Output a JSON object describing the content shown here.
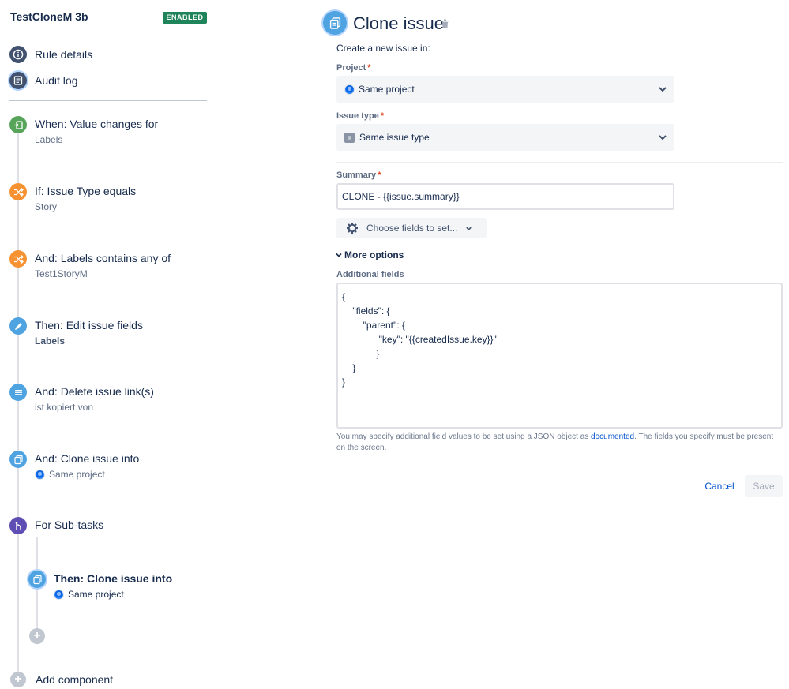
{
  "rule": {
    "name": "TestCloneM 3b",
    "status_badge": "ENABLED"
  },
  "nav": {
    "rule_details": "Rule details",
    "audit_log": "Audit log"
  },
  "components": [
    {
      "title": "When: Value changes for",
      "subtitle": "Labels",
      "color": "#57a55a",
      "icon": "trigger-icon"
    },
    {
      "title": "If: Issue Type equals",
      "subtitle": "Story",
      "color": "#f79232",
      "icon": "condition-icon"
    },
    {
      "title": "And: Labels contains any of",
      "subtitle": "Test1StoryM",
      "color": "#f79232",
      "icon": "condition-icon"
    },
    {
      "title": "Then: Edit issue fields",
      "subtitle": "Labels",
      "color": "#4fa3e0",
      "icon": "pencil-icon"
    },
    {
      "title": "And: Delete issue link(s)",
      "subtitle": "ist kopiert von",
      "color": "#4fa3e0",
      "icon": "list-icon"
    },
    {
      "title": "And: Clone issue into",
      "subtitle": "Same project",
      "color": "#4fa3e0",
      "icon": "clone-icon"
    },
    {
      "title": "For Sub-tasks",
      "subtitle": "",
      "color": "#5e4db2",
      "icon": "branch-icon"
    },
    {
      "title": "Then: Clone issue into",
      "subtitle": "Same project",
      "color": "#4fa3e0",
      "icon": "clone-icon"
    }
  ],
  "add_component": "Add component",
  "form": {
    "title": "Clone issue",
    "intro": "Create a new issue in:",
    "project_label": "Project",
    "project_value": "Same project",
    "issue_type_label": "Issue type",
    "issue_type_value": "Same issue type",
    "summary_label": "Summary",
    "summary_value": "CLONE - {{issue.summary}}",
    "choose_fields": "Choose fields to set...",
    "more_options": "More options",
    "additional_fields_label": "Additional fields",
    "additional_fields_lines": [
      "{",
      "    \"fields\": {",
      "        \"parent\": {",
      "              \"key\": \"{{createdIssue.key}}\"",
      "             }",
      "    }",
      "}"
    ],
    "help_before": "You may specify additional field values to be set using a JSON object as ",
    "help_link": "documented",
    "help_after": ". The fields you specify must be present on the screen.",
    "cancel": "Cancel",
    "save": "Save",
    "required_mark": "*"
  }
}
